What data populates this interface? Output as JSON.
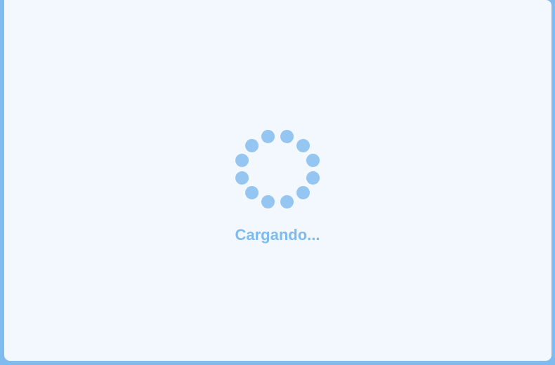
{
  "loader": {
    "message": "Cargando...",
    "dot_color": "#95c6f2",
    "text_color": "#7fbbee",
    "dot_count": 12,
    "icon": "spinner-icon"
  },
  "colors": {
    "frame_border": "#7fbbee",
    "background": "#f2f8fe"
  }
}
